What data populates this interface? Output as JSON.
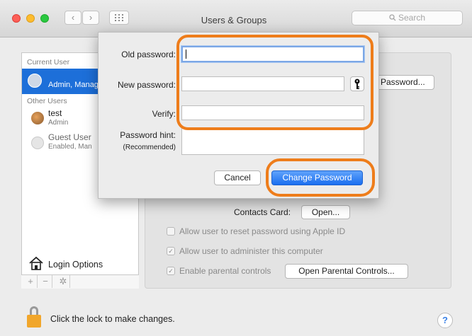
{
  "window": {
    "title": "Users & Groups",
    "search_placeholder": "Search"
  },
  "sidebar": {
    "current_user_header": "Current User",
    "current_user": {
      "name": "Admin, Manag"
    },
    "other_users_header": "Other Users",
    "users": [
      {
        "name": "test",
        "role": "Admin"
      },
      {
        "name": "Guest User",
        "role": "Enabled, Man"
      }
    ],
    "login_options": "Login Options",
    "add_glyph": "+",
    "remove_glyph": "−"
  },
  "main": {
    "change_password_partial": "Password...",
    "contacts_card_label": "Contacts Card:",
    "open_button": "Open...",
    "checkboxes": [
      {
        "label": "Allow user to reset password using Apple ID",
        "checked": false
      },
      {
        "label": "Allow user to administer this computer",
        "checked": true
      },
      {
        "label": "Enable parental controls",
        "checked": true
      }
    ],
    "parental_controls_button": "Open Parental Controls...",
    "lock_text": "Click the lock to make changes.",
    "help_glyph": "?"
  },
  "sheet": {
    "old_password_label": "Old password:",
    "new_password_label": "New password:",
    "verify_label": "Verify:",
    "hint_label": "Password hint:",
    "hint_sub": "(Recommended)",
    "old_password_value": "",
    "new_password_value": "",
    "verify_value": "",
    "hint_value": "",
    "cancel_label": "Cancel",
    "change_label": "Change Password"
  },
  "colors": {
    "accent": "#1b6ff0",
    "selection": "#1d6fd9",
    "callout": "#ee7d1b"
  }
}
